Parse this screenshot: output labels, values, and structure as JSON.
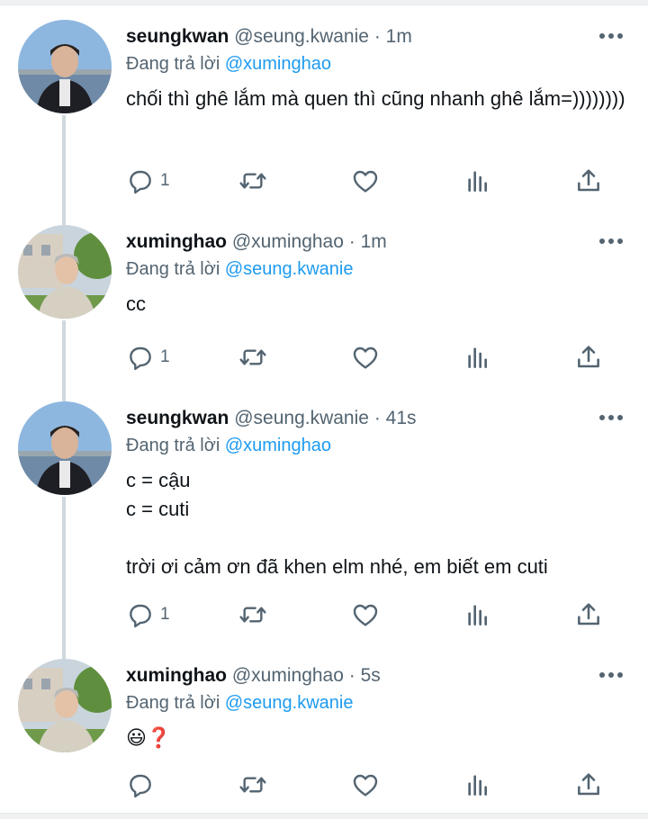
{
  "reply_prefix": "Đang trả lời",
  "icons": {
    "reply": "reply-icon",
    "retweet": "retweet-icon",
    "like": "heart-icon",
    "views": "analytics-icon",
    "share": "share-icon",
    "more": "more-icon"
  },
  "colors": {
    "mention": "#1d9bf0",
    "secondary_text": "#536471",
    "thread_line": "#cfd9de"
  },
  "tweets": [
    {
      "name": "seungkwan",
      "handle": "@seung.kwanie",
      "dot": "·",
      "time": "1m",
      "reply_to": "@xuminghao",
      "text": "chối thì ghê lắm mà quen thì cũng nhanh ghê lắm=))))))))",
      "reply_count": "1"
    },
    {
      "name": "xuminghao",
      "handle": "@xuminghao",
      "dot": "·",
      "time": "1m",
      "reply_to": "@seung.kwanie",
      "text": "cc",
      "reply_count": "1"
    },
    {
      "name": "seungkwan",
      "handle": "@seung.kwanie",
      "dot": "·",
      "time": "41s",
      "reply_to": "@xuminghao",
      "text": "c = cậu\nc = cuti\n\ntrời ơi cảm ơn đã khen elm nhé, em biết em cuti",
      "reply_count": "1"
    },
    {
      "name": "xuminghao",
      "handle": "@xuminghao",
      "dot": "·",
      "time": "5s",
      "reply_to": "@seung.kwanie",
      "text": "😃❓",
      "reply_count": ""
    }
  ]
}
